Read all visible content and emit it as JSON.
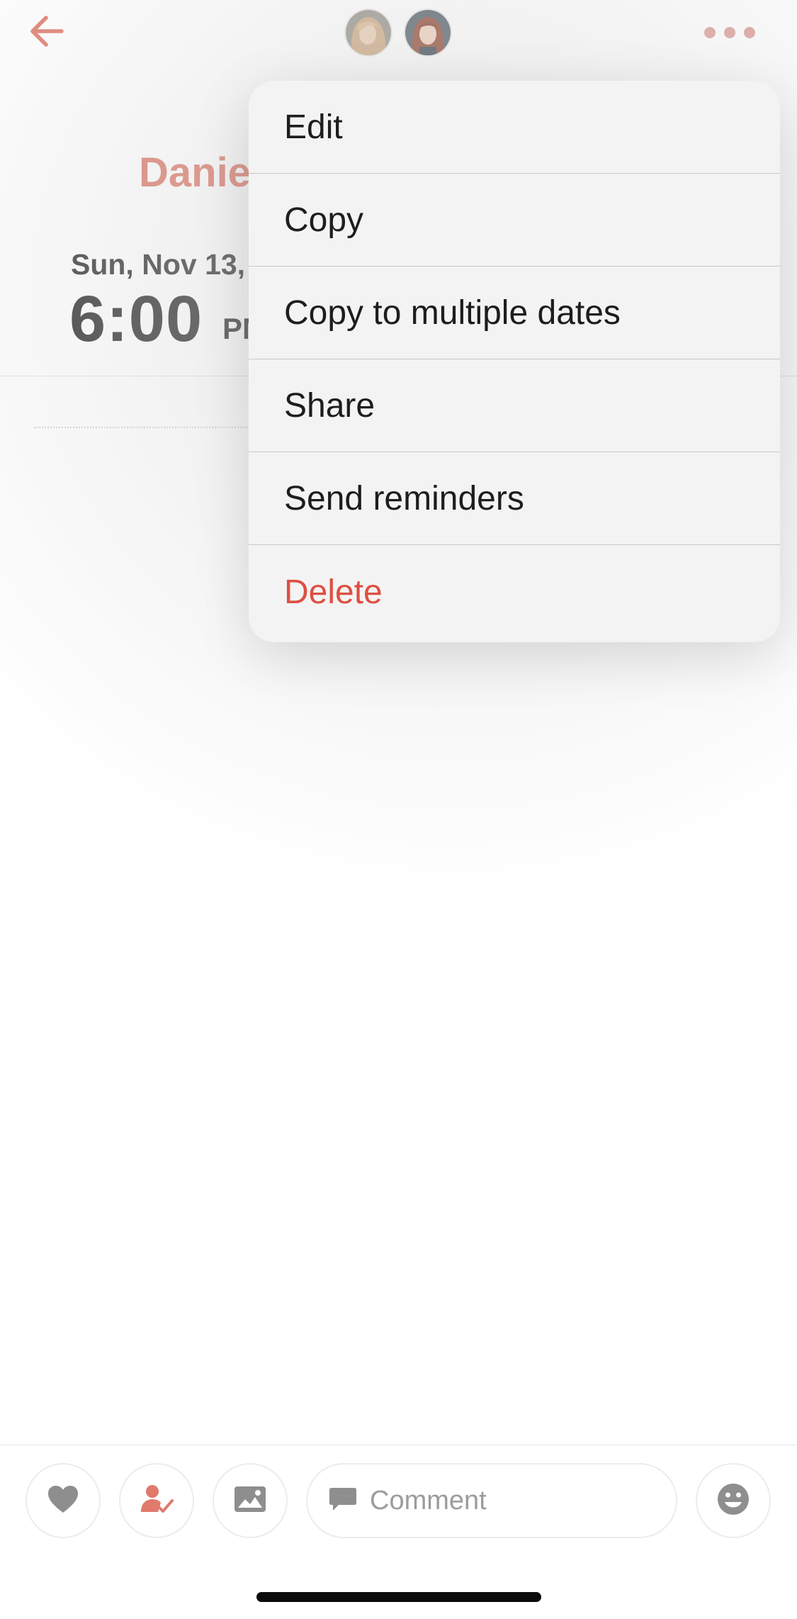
{
  "header": {
    "back_icon": "arrow-left-icon",
    "more_icon": "ellipsis-icon",
    "avatars": [
      {
        "name": "avatar-blonde",
        "hair": "#c9a37a",
        "skin": "#e9c9ad",
        "bg": "#8f8a82"
      },
      {
        "name": "avatar-redhead",
        "hair": "#8a3b23",
        "skin": "#f0cdb7",
        "bg": "#44525c"
      }
    ],
    "accent_color": "#e07a6c"
  },
  "event": {
    "title": "Danie",
    "date": "Sun, Nov 13,",
    "time": "6:00",
    "ampm": "PM"
  },
  "menu": {
    "items": [
      {
        "label": "Edit",
        "name": "menu-item-edit",
        "destructive": false
      },
      {
        "label": "Copy",
        "name": "menu-item-copy",
        "destructive": false
      },
      {
        "label": "Copy to multiple dates",
        "name": "menu-item-copy-multiple",
        "destructive": false
      },
      {
        "label": "Share",
        "name": "menu-item-share",
        "destructive": false
      },
      {
        "label": "Send reminders",
        "name": "menu-item-send-reminders",
        "destructive": false
      },
      {
        "label": "Delete",
        "name": "menu-item-delete",
        "destructive": true
      }
    ],
    "destructive_color": "#de4f43"
  },
  "bottom_bar": {
    "like_icon": "heart-icon",
    "rsvp_icon": "person-check-icon",
    "photo_icon": "image-icon",
    "comment_icon": "speech-bubble-icon",
    "comment_placeholder": "Comment",
    "emoji_icon": "smiley-icon"
  }
}
